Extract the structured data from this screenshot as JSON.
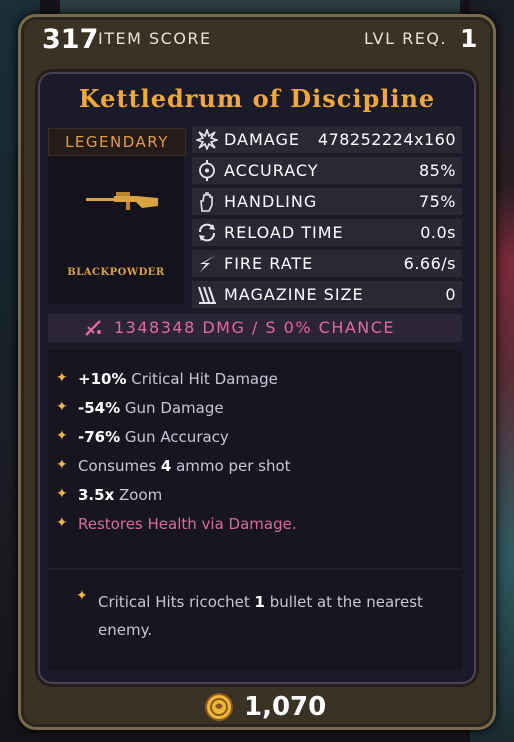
{
  "header": {
    "item_score": "317",
    "item_score_label": "ITEM SCORE",
    "level_req_label": "LVL REQ.",
    "level_req": "1"
  },
  "item": {
    "name": "Kettledrum of Discipline",
    "rarity": "LEGENDARY",
    "manufacturer": "BLACKPOWDER"
  },
  "stats": [
    {
      "icon": "damage-burst-icon",
      "label": "DAMAGE",
      "value": "478252224x160"
    },
    {
      "icon": "accuracy-crosshair-icon",
      "label": "ACCURACY",
      "value": "85%"
    },
    {
      "icon": "handling-hand-icon",
      "label": "HANDLING",
      "value": "75%"
    },
    {
      "icon": "reload-arrows-icon",
      "label": "RELOAD TIME",
      "value": "0.0s"
    },
    {
      "icon": "fire-rate-icon",
      "label": "FIRE RATE",
      "value": "6.66/s"
    },
    {
      "icon": "magazine-claw-icon",
      "label": "MAGAZINE SIZE",
      "value": "0"
    }
  ],
  "dps": {
    "text": "1348348 DMG / S   0% CHANCE"
  },
  "perks": [
    {
      "bold": "+10%",
      "text": " Critical Hit Damage"
    },
    {
      "bold": "-54%",
      "text": " Gun Damage"
    },
    {
      "bold": "-76%",
      "text": " Gun Accuracy"
    },
    {
      "pre": "Consumes ",
      "bold": "4",
      "text": " ammo per shot"
    },
    {
      "bold": "3.5x",
      "text": " Zoom"
    },
    {
      "text": "Restores Health via Damage."
    }
  ],
  "special": {
    "pre": "Critical Hits ricochet ",
    "bold": "1",
    "post": " bullet at the nearest enemy."
  },
  "price": "1,070",
  "colors": {
    "title": "#f0a83a",
    "rarity": "#e39a4a",
    "dps": "#e16a9e",
    "perk_bullet": "#f3b44a",
    "healing_perk": "#d86aa0"
  }
}
